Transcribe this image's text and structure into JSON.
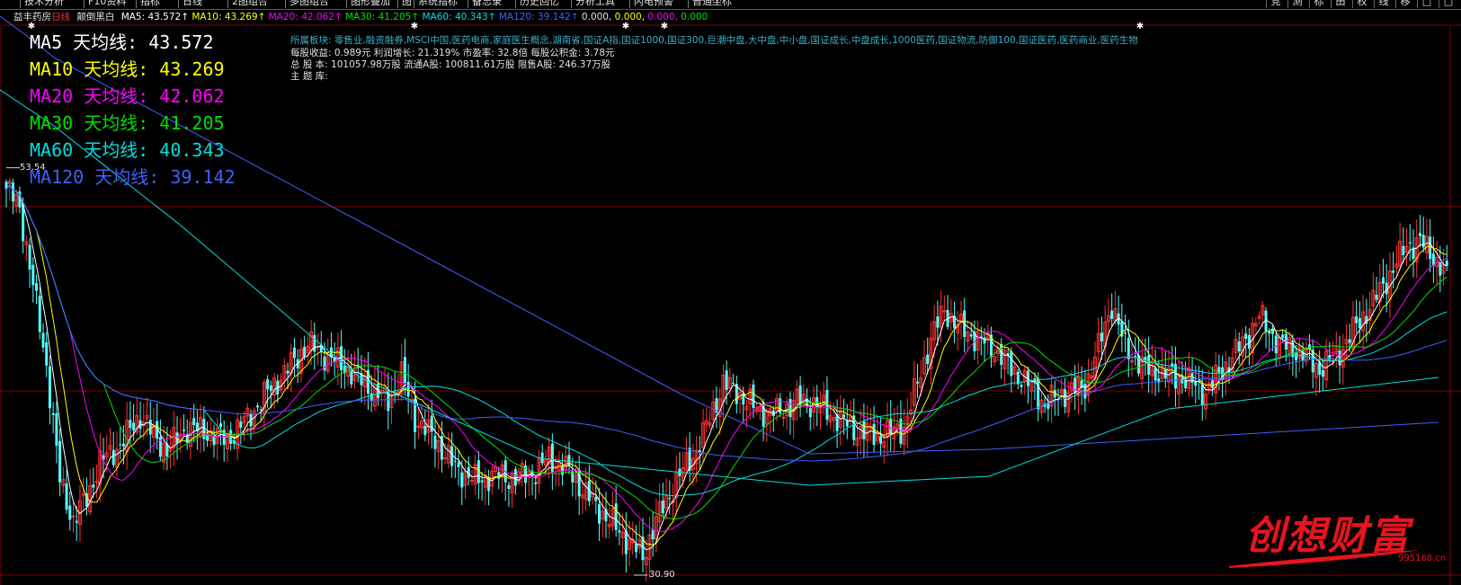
{
  "toolbar": {
    "items": [
      "技术分析",
      "F10资料",
      "指标",
      "日线",
      "2图组合",
      "多图组合",
      "图形叠加",
      "图",
      "系统指标",
      "备忘录",
      "历史回忆",
      "分析工具",
      "闪电预警",
      "普通坐标"
    ],
    "right_items": [
      "竞",
      "测",
      "标",
      "田",
      "权",
      "线",
      "移",
      "□",
      "□"
    ]
  },
  "infobar": {
    "stock_name": "益丰药房",
    "period": "日线",
    "mode": "颠倒黑白",
    "ma5": "MA5: 43.572↑",
    "ma10": "MA10: 43.269↑",
    "ma20": "MA20: 42.062↑",
    "ma30": "MA30: 41.205↑",
    "ma60": "MA60: 40.343↑",
    "ma120": "MA120: 39.142↑",
    "extra1": "0.000,",
    "extra2": "0.000,",
    "extra3": "0.000,",
    "extra4": "0.000"
  },
  "legend": [
    {
      "text": "MA5 天均线: 43.572",
      "color": "#ffffff"
    },
    {
      "text": "MA10 天均线: 43.269",
      "color": "#ffff00"
    },
    {
      "text": "MA20 天均线: 42.062",
      "color": "#ff00ff"
    },
    {
      "text": "MA30 天均线: 41.205",
      "color": "#00e000"
    },
    {
      "text": "MA60 天均线: 40.343",
      "color": "#00e0e0"
    },
    {
      "text": "MA120 天均线: 39.142",
      "color": "#4060ff"
    }
  ],
  "fundamentals": {
    "sectors_label": "所属板块:",
    "sectors": "零售业,融资融券,MSCI中国,医药电商,家庭医生概念,湖南省,国证A指,国证1000,国证300,巨潮中盘,大中盘,中小盘,国证成长,中盘成长,1000医药,国证物流,防御100,国证医药,医药商业,医药生物",
    "eps": "每股收益: 0.989元 利润增长: 21.319% 市盈率: 32.8倍  每股公积金: 3.78元",
    "shares": "总 股 本: 101057.98万股 流通A股: 100811.61万股 限售A股: 246.37万股",
    "theme": "主 题 库:"
  },
  "price_labels": {
    "high": "53.54",
    "low": "30.90"
  },
  "watermark": {
    "text": "创想财富",
    "url": "995168.cn"
  },
  "colors": {
    "up": "#ff3232",
    "down": "#54ffff",
    "ma5": "#ffffff",
    "ma10": "#ffff00",
    "ma20": "#ff00ff",
    "ma30": "#00e000",
    "ma60": "#00e0e0",
    "ma120": "#4060ff",
    "grid": "#800000"
  }
}
